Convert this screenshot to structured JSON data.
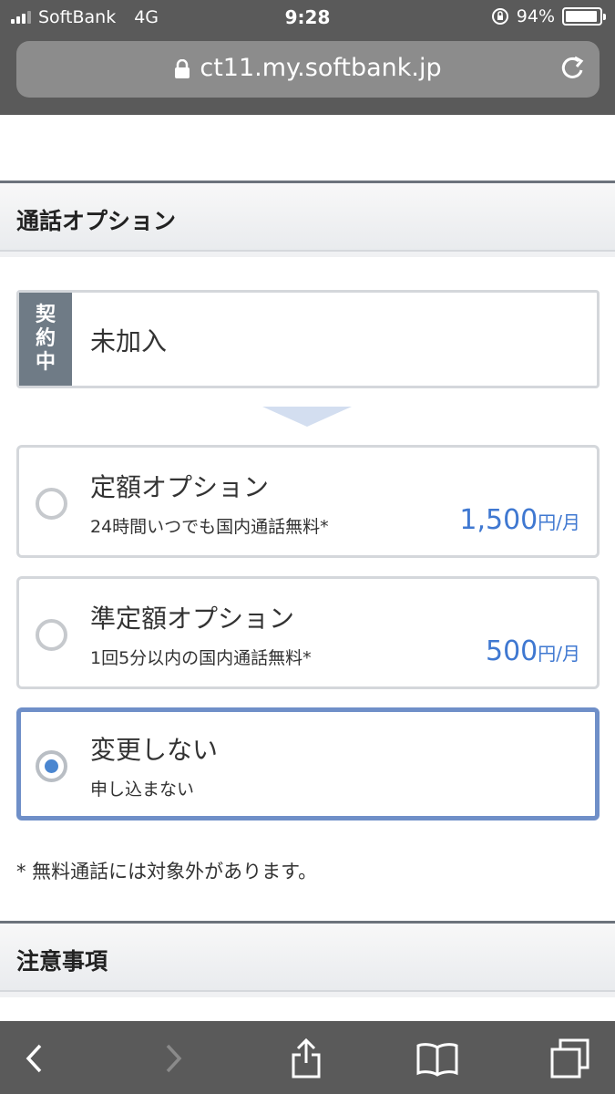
{
  "status_bar": {
    "carrier": "SoftBank",
    "network": "4G",
    "time": "9:28",
    "battery_text": "94%",
    "battery_level": 0.94
  },
  "url_bar": {
    "url": "ct11.my.softbank.jp",
    "lock_icon": "lock-icon",
    "reload_icon": "reload-icon"
  },
  "section_call_option": {
    "title": "通話オプション"
  },
  "current_contract": {
    "tag_chars": [
      "契",
      "約",
      "中"
    ],
    "value": "未加入"
  },
  "options": [
    {
      "name": "定額オプション",
      "description": "24時間いつでも国内通話無料*",
      "price": "1,500",
      "unit": "円/月",
      "selected": false
    },
    {
      "name": "準定額オプション",
      "description": "1回5分以内の国内通話無料*",
      "price": "500",
      "unit": "円/月",
      "selected": false
    },
    {
      "name": "変更しない",
      "description": "申し込まない",
      "price": "",
      "unit": "",
      "selected": true
    }
  ],
  "footnote": "* 無料通話には対象外があります。",
  "section_notes": {
    "title": "注意事項"
  },
  "colors": {
    "accent_blue": "#3f78d1",
    "selected_border": "#6f8fc8",
    "tag_bg": "#6f7b86",
    "chrome_bg": "#5a5a5a"
  },
  "toolbar": {
    "icons": [
      "back-icon",
      "forward-icon",
      "share-icon",
      "bookmarks-icon",
      "tabs-icon"
    ]
  }
}
